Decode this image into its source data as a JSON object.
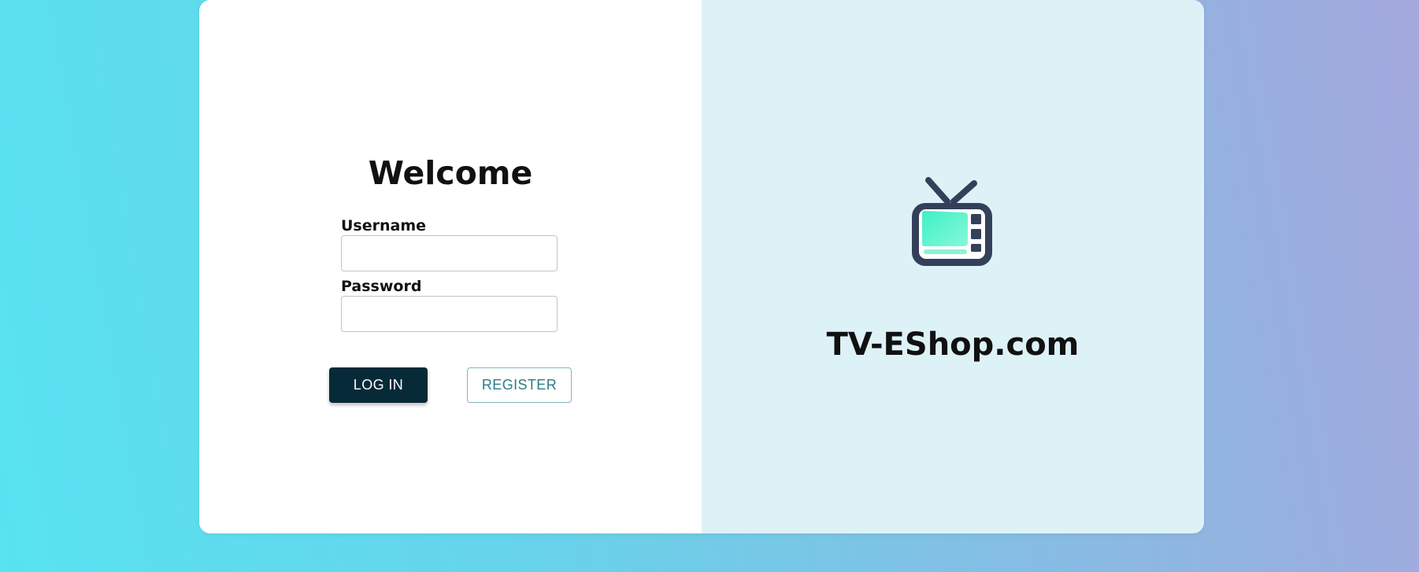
{
  "login": {
    "title": "Welcome",
    "username_label": "Username",
    "username_value": "",
    "password_label": "Password",
    "password_value": "",
    "login_button": "LOG IN",
    "register_button": "REGISTER"
  },
  "brand": {
    "name": "TV-EShop.com",
    "logo_icon": "tv-icon"
  },
  "colors": {
    "background_gradient_start": "#58e3f1",
    "background_gradient_end": "#a4a8dd",
    "right_panel": "#ddf2f7",
    "login_button": "#062a38",
    "register_text": "#2b7c86",
    "tv_frame": "#34405a",
    "tv_screen_start": "#3ef0c4",
    "tv_screen_end": "#7ef7d8"
  }
}
